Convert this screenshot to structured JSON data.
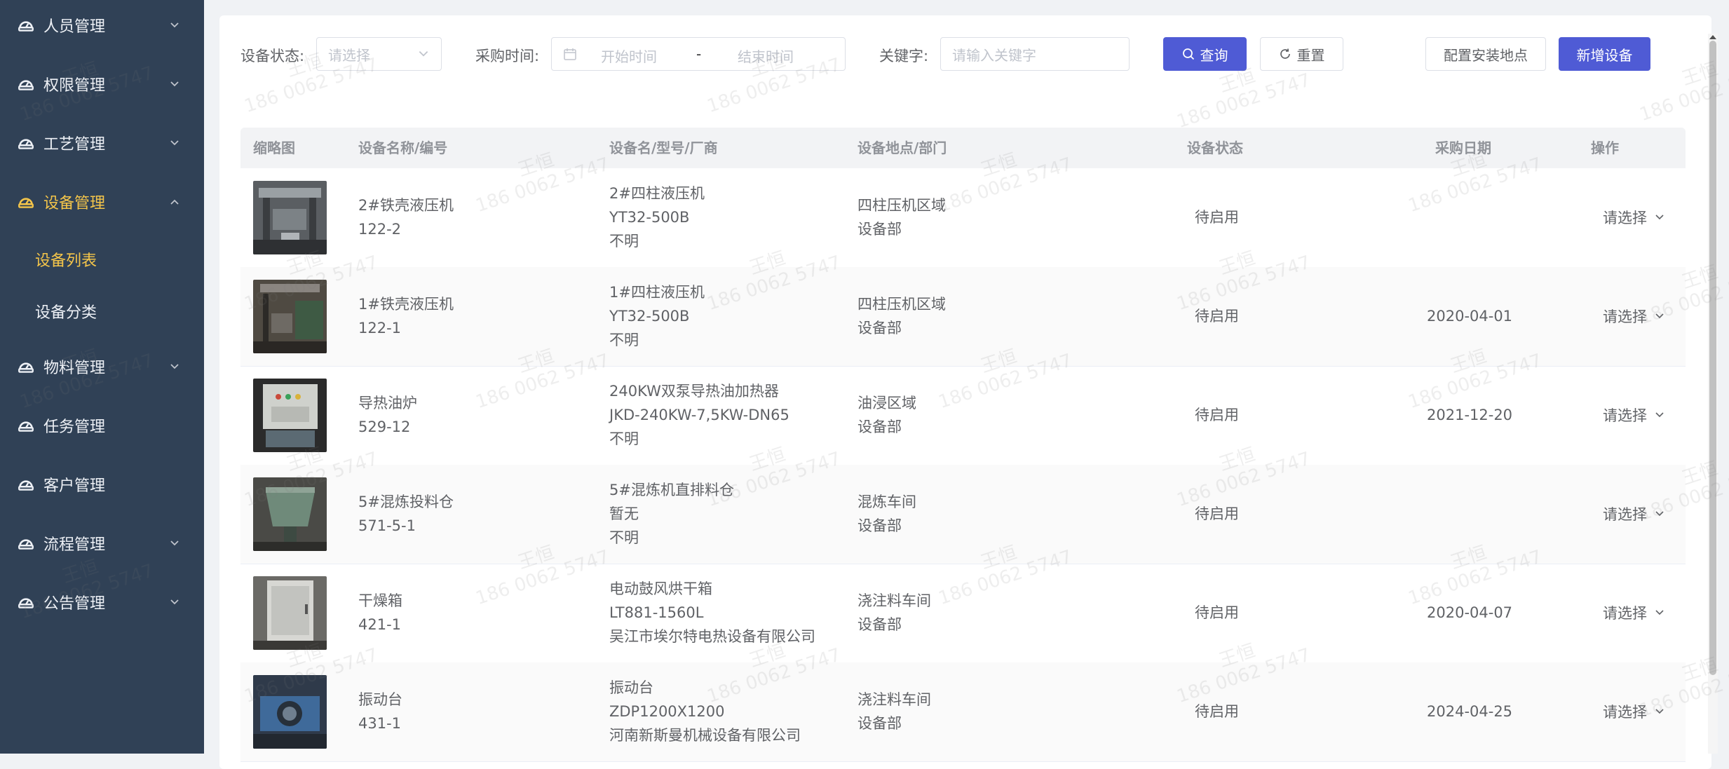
{
  "sidebar": {
    "items": [
      {
        "label": "人员管理"
      },
      {
        "label": "权限管理"
      },
      {
        "label": "工艺管理"
      },
      {
        "label": "设备管理"
      },
      {
        "label": "物料管理"
      },
      {
        "label": "任务管理"
      },
      {
        "label": "客户管理"
      },
      {
        "label": "流程管理"
      },
      {
        "label": "公告管理"
      }
    ],
    "submenu": [
      {
        "label": "设备列表"
      },
      {
        "label": "设备分类"
      }
    ],
    "active_color": "#f4c54a",
    "bg_color": "#304156"
  },
  "filters": {
    "status_label": "设备状态:",
    "status_placeholder": "请选择",
    "purchase_label": "采购时间:",
    "start_placeholder": "开始时间",
    "range_sep": "-",
    "end_placeholder": "结束时间",
    "keyword_label": "关键字:",
    "keyword_placeholder": "请输入关键字",
    "search_btn": "查询",
    "reset_btn": "重置",
    "config_btn": "配置安装地点",
    "add_btn": "新增设备"
  },
  "table": {
    "columns": [
      "缩略图",
      "设备名称/编号",
      "设备名/型号/厂商",
      "设备地点/部门",
      "设备状态",
      "采购日期",
      "操作"
    ],
    "rows": [
      {
        "name": "2#铁壳液压机",
        "code": "122-2",
        "model_name": "2#四柱液压机",
        "model": "YT32-500B",
        "vendor": "不明",
        "location": "四柱压机区域",
        "dept": "设备部",
        "status": "待启用",
        "date": "",
        "op": "请选择"
      },
      {
        "name": "1#铁壳液压机",
        "code": "122-1",
        "model_name": "1#四柱液压机",
        "model": "YT32-500B",
        "vendor": "不明",
        "location": "四柱压机区域",
        "dept": "设备部",
        "status": "待启用",
        "date": "2020-04-01",
        "op": "请选择"
      },
      {
        "name": "导热油炉",
        "code": "529-12",
        "model_name": "240KW双泵导热油加热器",
        "model": "JKD-240KW-7,5KW-DN65",
        "vendor": "不明",
        "location": "油浸区域",
        "dept": "设备部",
        "status": "待启用",
        "date": "2021-12-20",
        "op": "请选择"
      },
      {
        "name": "5#混炼投料仓",
        "code": "571-5-1",
        "model_name": "5#混炼机直排料仓",
        "model": "暂无",
        "vendor": "不明",
        "location": "混炼车间",
        "dept": "设备部",
        "status": "待启用",
        "date": "",
        "op": "请选择"
      },
      {
        "name": "干燥箱",
        "code": "421-1",
        "model_name": "电动鼓风烘干箱",
        "model": "LT881-1560L",
        "vendor": "吴江市埃尔特电热设备有限公司",
        "location": "浇注料车间",
        "dept": "设备部",
        "status": "待启用",
        "date": "2020-04-07",
        "op": "请选择"
      },
      {
        "name": "振动台",
        "code": "431-1",
        "model_name": "振动台",
        "model": "ZDP1200X1200",
        "vendor": "河南新斯曼机械设备有限公司",
        "location": "浇注料车间",
        "dept": "设备部",
        "status": "待启用",
        "date": "2024-04-25",
        "op": "请选择"
      }
    ]
  },
  "watermark": {
    "line1": "王恒",
    "line2": "186 0062 5747"
  },
  "colors": {
    "primary": "#4f5bd5",
    "sidebar": "#304156",
    "active": "#f4c54a"
  }
}
